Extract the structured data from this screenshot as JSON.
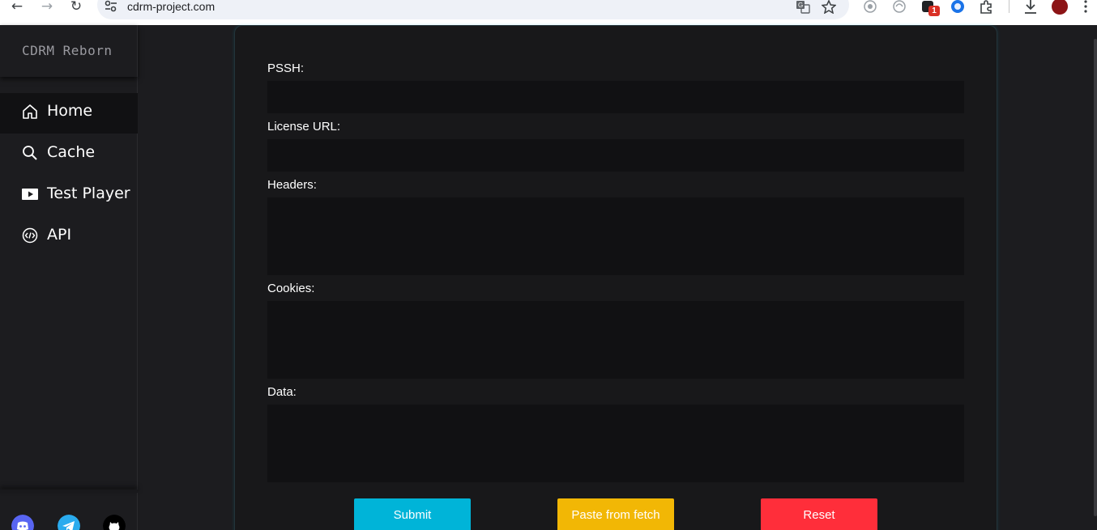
{
  "browser": {
    "url": "cdrm-project.com",
    "extension_badge": "1"
  },
  "sidebar": {
    "brand": "CDRM Reborn",
    "items": [
      {
        "label": "Home",
        "icon": "home-icon",
        "active": true
      },
      {
        "label": "Cache",
        "icon": "search-icon",
        "active": false
      },
      {
        "label": "Test Player",
        "icon": "play-icon",
        "active": false
      },
      {
        "label": "API",
        "icon": "code-icon",
        "active": false
      }
    ],
    "social": [
      "discord-icon",
      "telegram-icon",
      "github-icon"
    ]
  },
  "form": {
    "pssh_label": "PSSH:",
    "pssh_value": "",
    "license_label": "License URL:",
    "license_value": "",
    "headers_label": "Headers:",
    "headers_value": "",
    "cookies_label": "Cookies:",
    "cookies_value": "",
    "data_label": "Data:",
    "data_value": ""
  },
  "buttons": {
    "submit": "Submit",
    "paste": "Paste from fetch",
    "reset": "Reset"
  },
  "colors": {
    "submit": "#00b4d8",
    "paste": "#f2b705",
    "reset": "#ff2e3a",
    "background": "#1c1c1f",
    "card": "#18181a"
  }
}
